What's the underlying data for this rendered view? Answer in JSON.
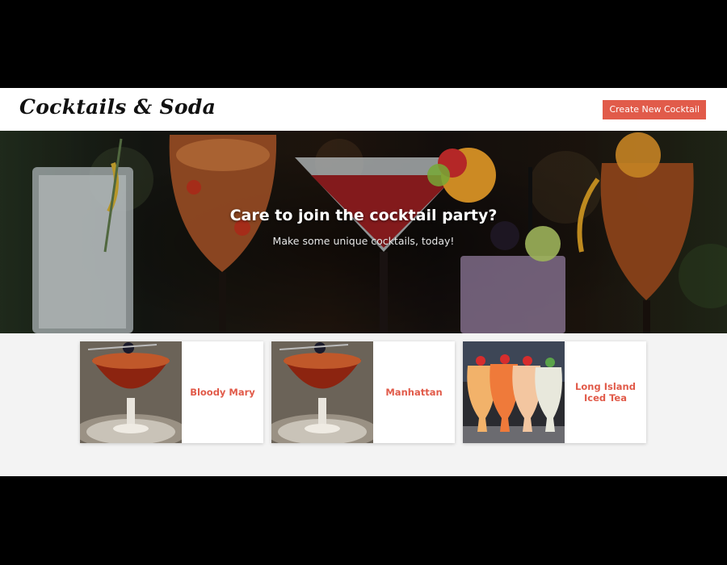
{
  "header": {
    "brand": "Cocktails & Soda",
    "create_button": "Create New Cocktail"
  },
  "hero": {
    "title": "Care to join the cocktail party?",
    "subtitle": "Make some unique cocktails, today!"
  },
  "cards": [
    {
      "name": "Bloody Mary",
      "image": "coupe-cocktail-photo"
    },
    {
      "name": "Manhattan",
      "image": "coupe-cocktail-photo"
    },
    {
      "name": "Long Island Iced Tea",
      "image": "hurricane-glasses-photo"
    }
  ],
  "colors": {
    "accent": "#e15b4a",
    "header_bg": "#ffffff",
    "page_bg": "#f3f3f3",
    "frame_bg": "#000000"
  }
}
